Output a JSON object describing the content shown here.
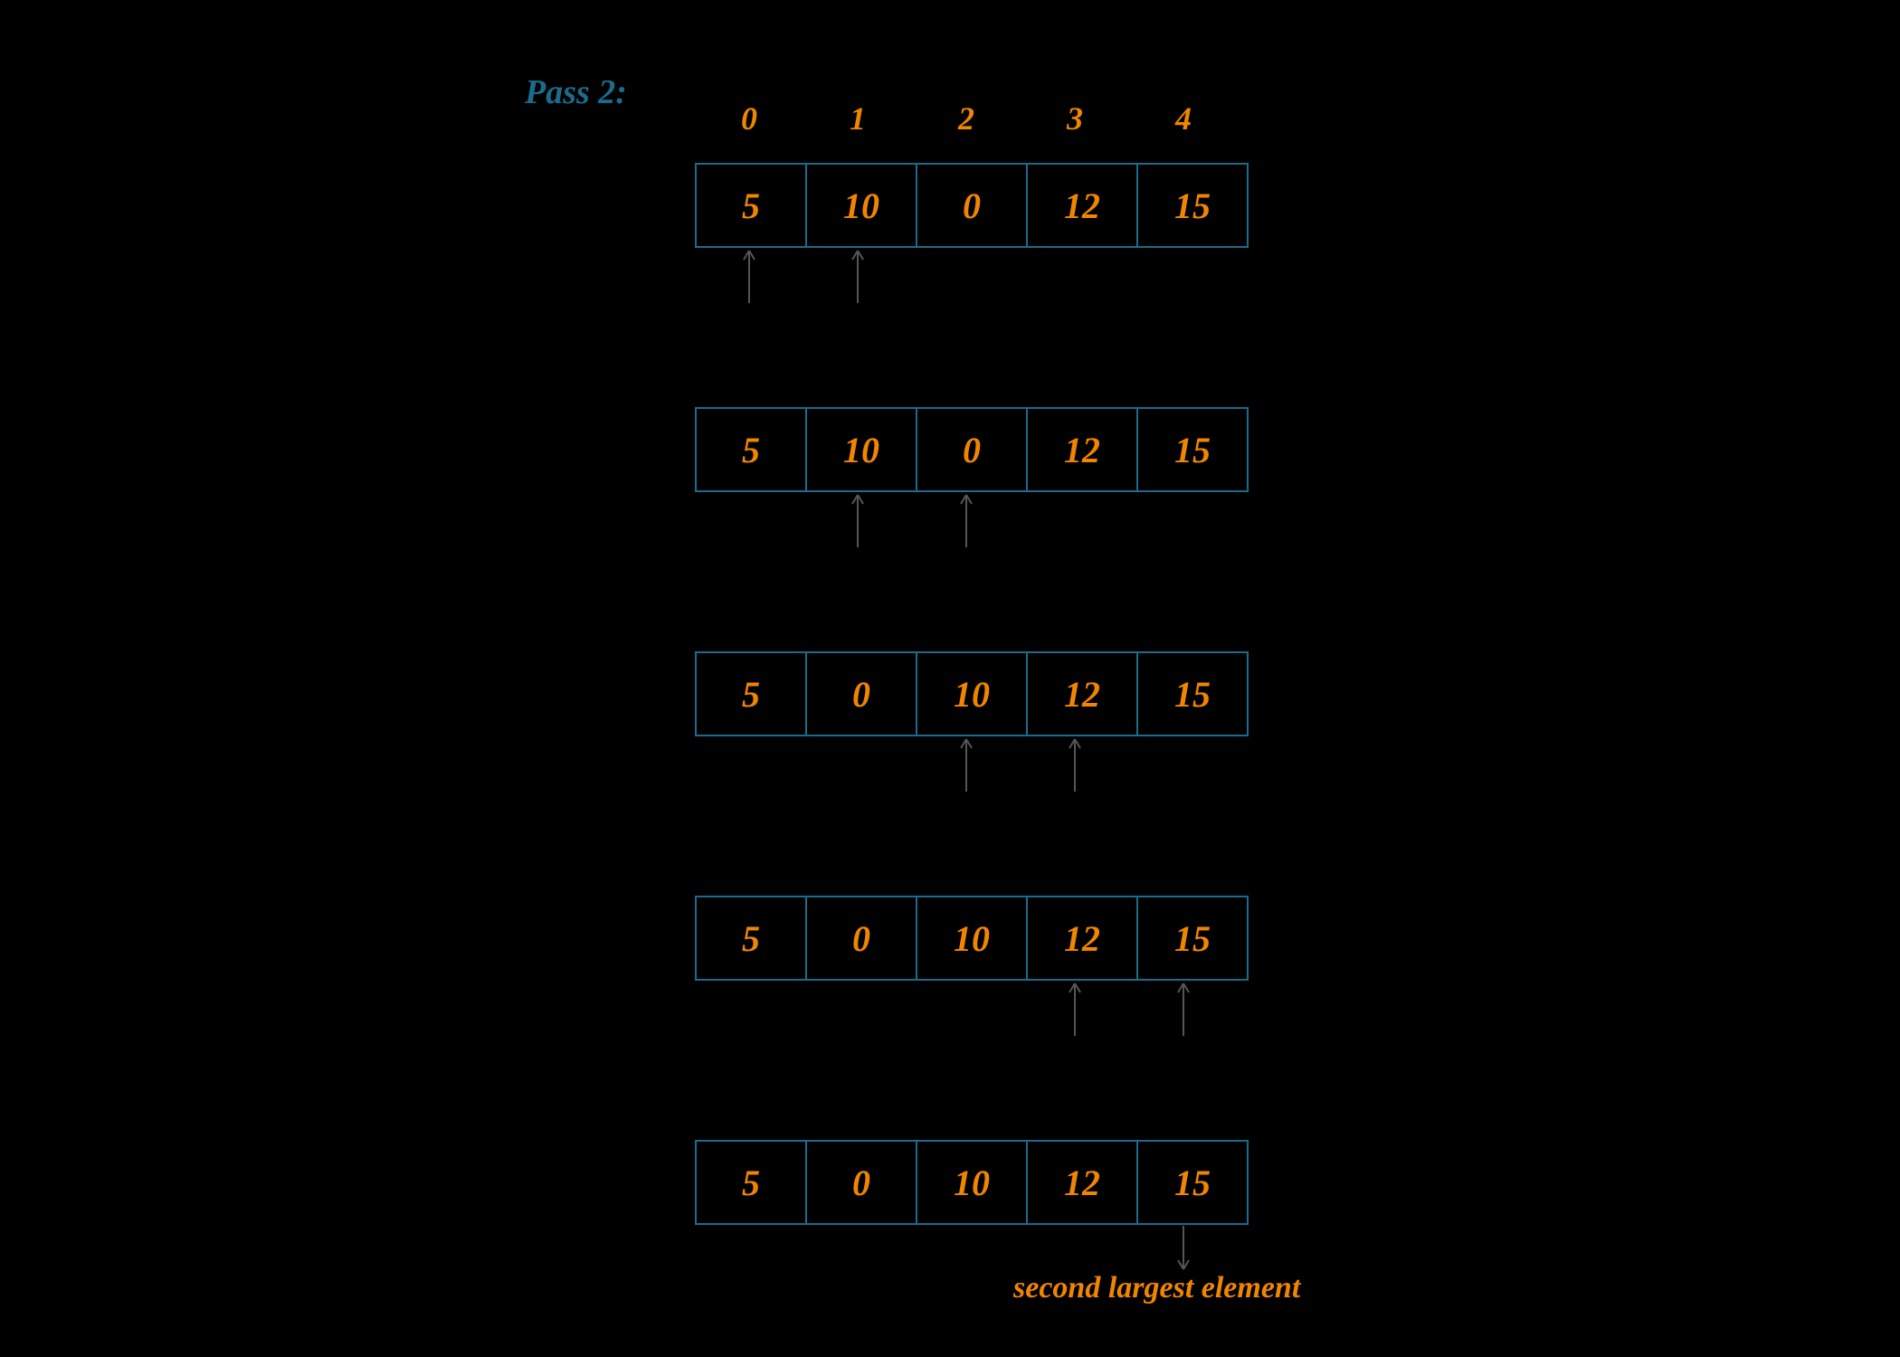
{
  "title": "Pass 2:",
  "indices": [
    "0",
    "1",
    "2",
    "3",
    "4"
  ],
  "rows": [
    {
      "values": [
        "5",
        "10",
        "0",
        "12",
        "15"
      ],
      "arrows": [
        0,
        1
      ]
    },
    {
      "values": [
        "5",
        "10",
        "0",
        "12",
        "15"
      ],
      "arrows": [
        1,
        2
      ]
    },
    {
      "values": [
        "5",
        "0",
        "10",
        "12",
        "15"
      ],
      "arrows": [
        2,
        3
      ]
    },
    {
      "values": [
        "5",
        "0",
        "10",
        "12",
        "15"
      ],
      "arrows": [
        3,
        4
      ]
    },
    {
      "values": [
        "5",
        "0",
        "10",
        "12",
        "15"
      ],
      "arrows": []
    }
  ],
  "annotation": "second largest element"
}
